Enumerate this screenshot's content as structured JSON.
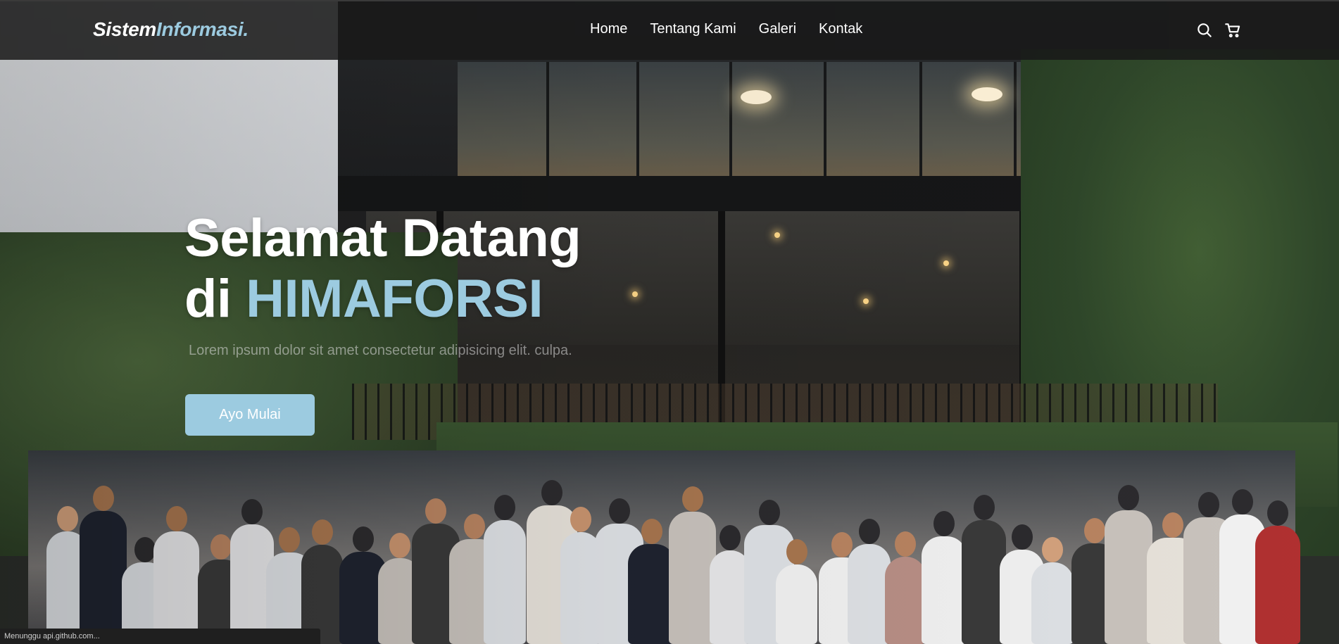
{
  "brand": {
    "part1": "Sistem",
    "part2": "Informasi",
    "dot": "."
  },
  "nav": {
    "items": [
      {
        "label": "Home"
      },
      {
        "label": "Tentang Kami"
      },
      {
        "label": "Galeri"
      },
      {
        "label": "Kontak"
      }
    ]
  },
  "tools": {
    "search_icon": "search-icon",
    "cart_icon": "cart-icon"
  },
  "hero": {
    "line1": "Selamat Datang",
    "line2_prefix": "di ",
    "line2_accent": "HIMAFORSI",
    "subtitle": "Lorem ipsum dolor sit amet consectetur adipisicing elit. culpa.",
    "cta_label": "Ayo Mulai"
  },
  "status_bar": {
    "text": "Menunggu api.github.com..."
  },
  "colors": {
    "accent": "#9ccbe0",
    "header_bg": "#181818",
    "text": "#ffffff"
  }
}
